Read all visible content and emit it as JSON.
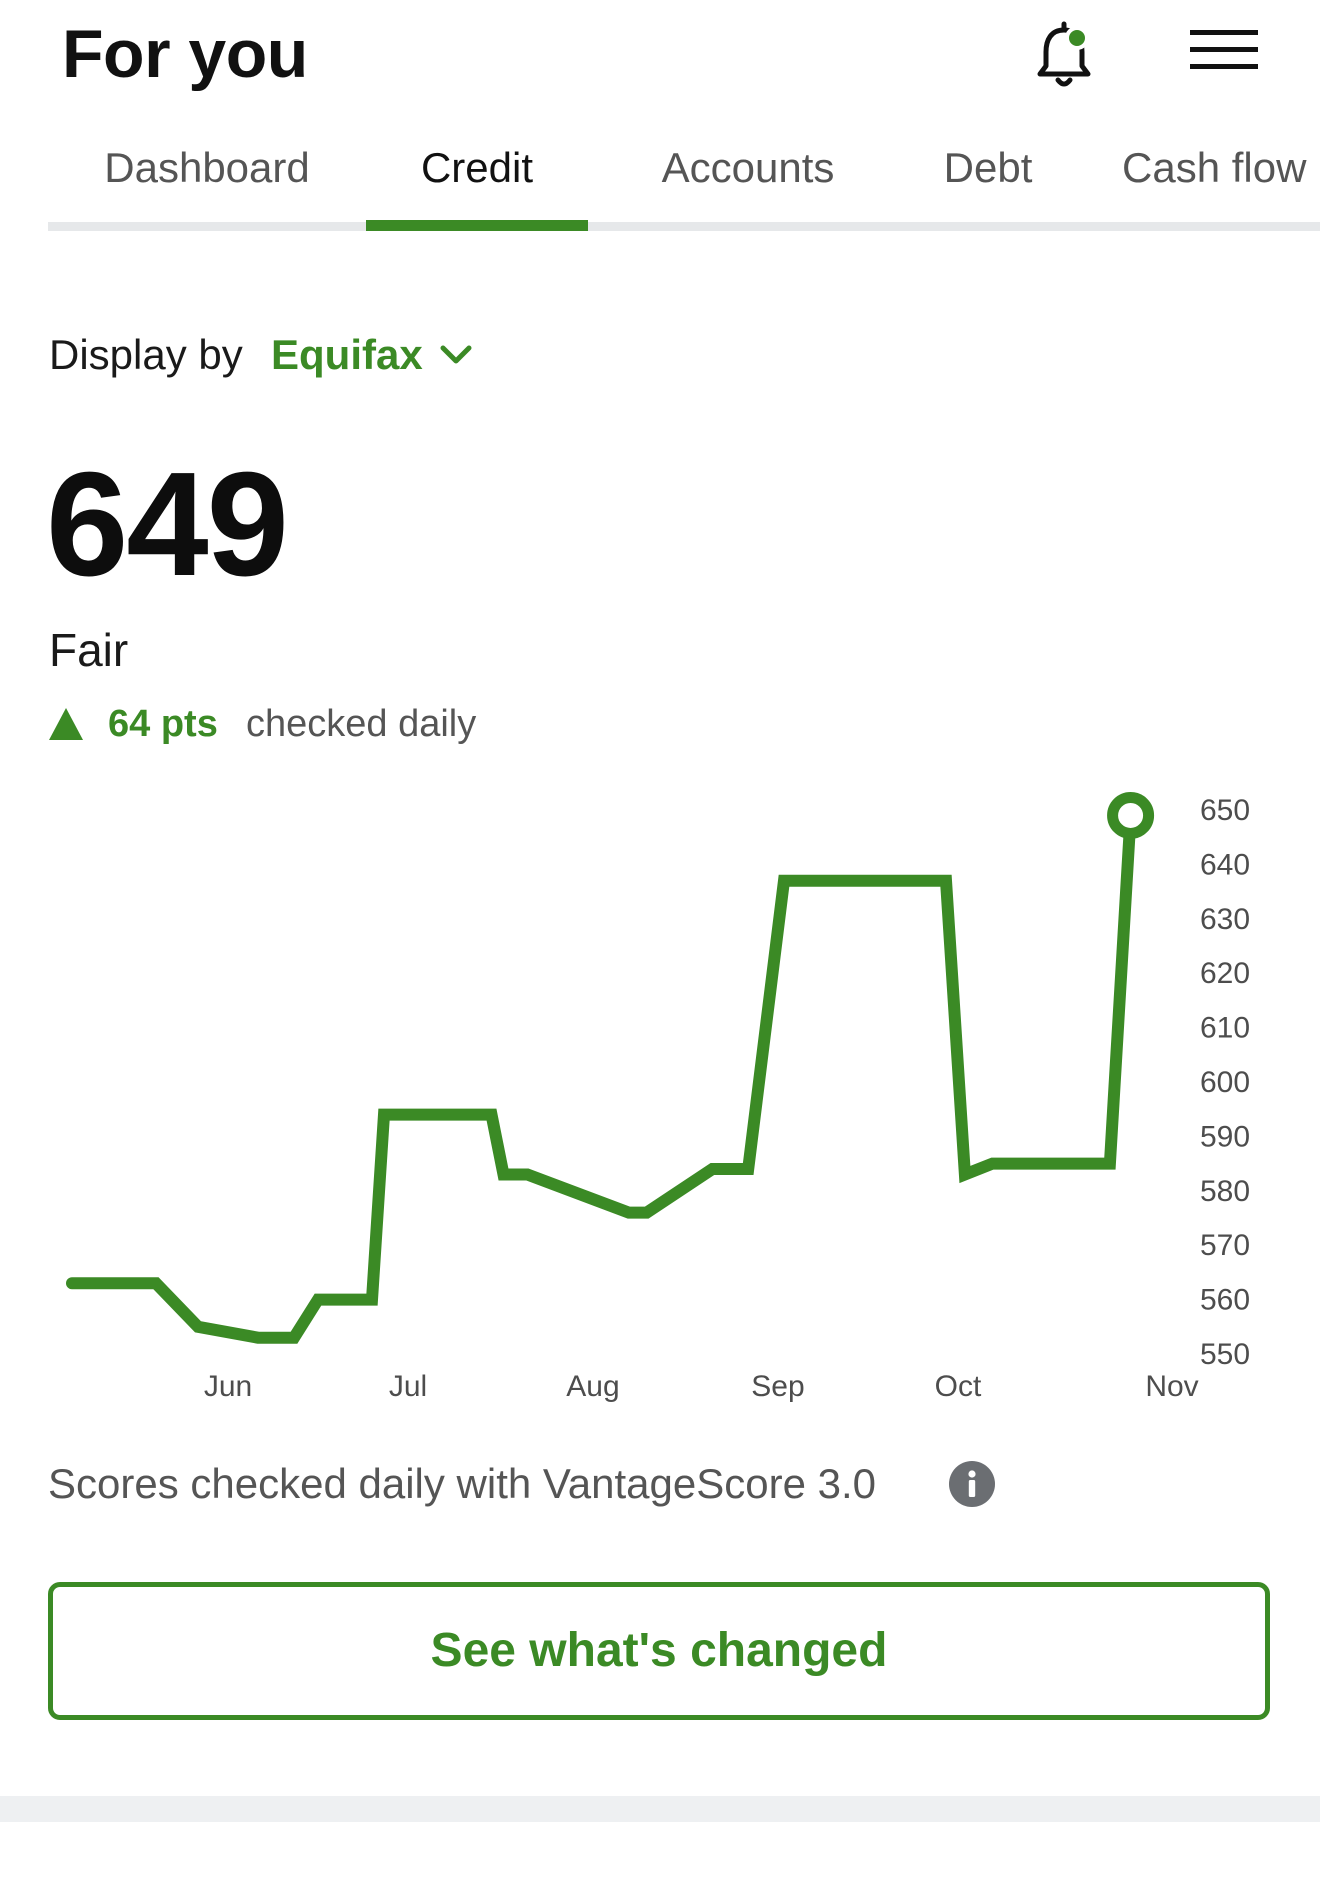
{
  "header": {
    "title": "For you",
    "bell_icon": "bell-notification-icon",
    "menu_icon": "hamburger-menu-icon",
    "notification_dot_color": "#3b8a25"
  },
  "tabs": [
    {
      "label": "Dashboard",
      "active": false
    },
    {
      "label": "Credit",
      "active": true
    },
    {
      "label": "Accounts",
      "active": false
    },
    {
      "label": "Debt",
      "active": false
    },
    {
      "label": "Cash flow",
      "active": false
    }
  ],
  "display_by": {
    "label": "Display by",
    "selected": "Equifax"
  },
  "score": {
    "value": "649",
    "rating": "Fair",
    "change": "64 pts",
    "change_direction": "up",
    "note": "checked daily"
  },
  "chart_data": {
    "type": "line",
    "title": "",
    "xlabel": "",
    "ylabel": "",
    "x_ticks": [
      "Jun",
      "Jul",
      "Aug",
      "Sep",
      "Oct",
      "Nov"
    ],
    "y_ticks": [
      650,
      640,
      630,
      620,
      610,
      600,
      590,
      580,
      570,
      560,
      550
    ],
    "ylim": [
      550,
      650
    ],
    "y_axis_position": "right",
    "grid": false,
    "color": "#3b8a25",
    "series": [
      {
        "points": [
          {
            "x": "May 6",
            "y": 563
          },
          {
            "x": "May 20",
            "y": 563
          },
          {
            "x": "May 27",
            "y": 555
          },
          {
            "x": "Jun 6",
            "y": 553
          },
          {
            "x": "Jun 12",
            "y": 553
          },
          {
            "x": "Jun 16",
            "y": 560
          },
          {
            "x": "Jun 25",
            "y": 560
          },
          {
            "x": "Jun 27",
            "y": 594
          },
          {
            "x": "Jul 15",
            "y": 594
          },
          {
            "x": "Jul 17",
            "y": 583
          },
          {
            "x": "Jul 21",
            "y": 583
          },
          {
            "x": "Aug 7",
            "y": 576
          },
          {
            "x": "Aug 10",
            "y": 576
          },
          {
            "x": "Aug 21",
            "y": 584
          },
          {
            "x": "Aug 27",
            "y": 584
          },
          {
            "x": "Sep 2",
            "y": 637
          },
          {
            "x": "Sep 29",
            "y": 637
          },
          {
            "x": "Oct 2",
            "y": 583
          },
          {
            "x": "Oct 6",
            "y": 585
          },
          {
            "x": "Oct 23",
            "y": 585
          },
          {
            "x": "Oct 26",
            "y": 649
          }
        ]
      }
    ],
    "end_marker": {
      "x": "Oct 26",
      "y": 649
    }
  },
  "footer": {
    "vantage_text": "Scores checked daily with VantageScore 3.0",
    "info_icon": "info-icon",
    "cta_label": "See what's changed"
  }
}
